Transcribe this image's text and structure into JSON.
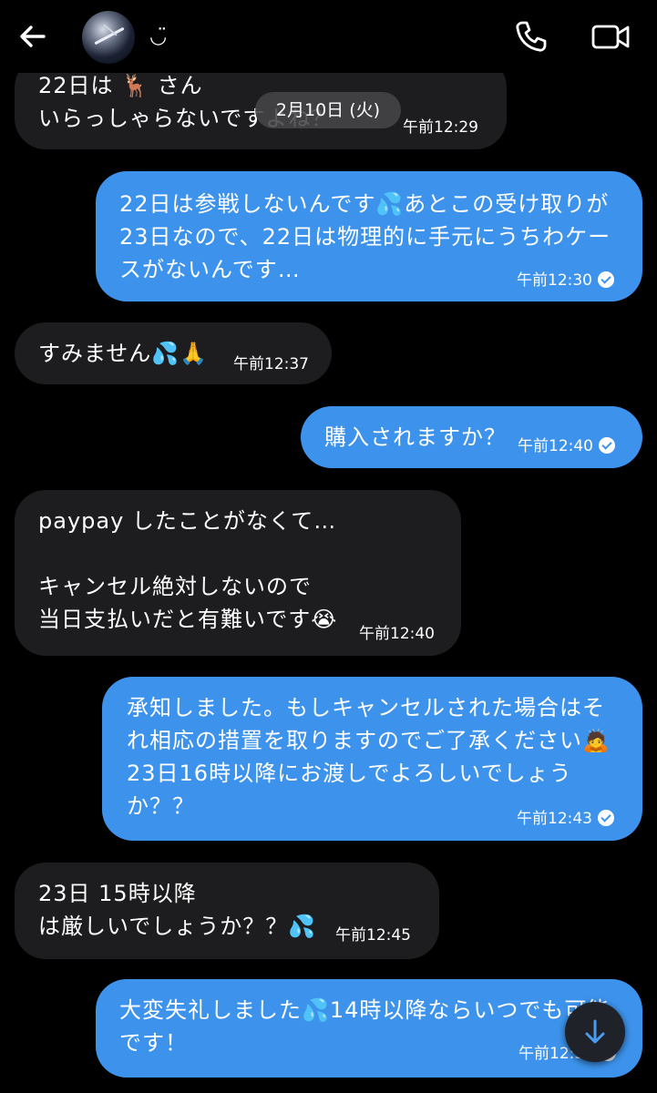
{
  "header": {
    "contact_name": "◡̈",
    "back_icon": "arrow-left-icon",
    "phone_icon": "phone-icon",
    "video_icon": "video-camera-icon"
  },
  "date_divider": "2月10日 (火)",
  "messages": [
    {
      "from": "them",
      "text": "22日は 🦌 さん\nいらっしゃらないですよね？",
      "time": "午前12:29"
    },
    {
      "from": "me",
      "text": "22日は参戦しないんです💦あとこの受け取りが\n23日なので、22日は物理的に手元にうちわケー\nスがないんです…",
      "time": "午前12:30",
      "status": "sent"
    },
    {
      "from": "them",
      "text": "すみません💦🙏",
      "time": "午前12:37"
    },
    {
      "from": "me",
      "text": "購入されますか？",
      "time": "午前12:40",
      "status": "sent"
    },
    {
      "from": "them",
      "text": "paypay したことがなくて…\n\nキャンセル絶対しないので\n当日支払いだと有難いです😭",
      "time": "午前12:40"
    },
    {
      "from": "me",
      "text": "承知しました。もしキャンセルされた場合はそ\nれ相応の措置を取りますのでご了承ください🙇\n23日16時以降にお渡しでよろしいでしょう\nか？？",
      "time": "午前12:43",
      "status": "sent"
    },
    {
      "from": "them",
      "text": "23日 15時以降\nは厳しいでしょうか？？💦",
      "time": "午前12:45"
    },
    {
      "from": "me",
      "text": "大変失礼しました💦14時以降ならいつでも可能\nです！",
      "time": "午前12:50",
      "status": "sent"
    }
  ],
  "scroll_button_icon": "arrow-down-icon",
  "colors": {
    "incoming_bubble": "#1d1d1f",
    "outgoing_bubble": "#3d93ec",
    "background": "#000000"
  }
}
